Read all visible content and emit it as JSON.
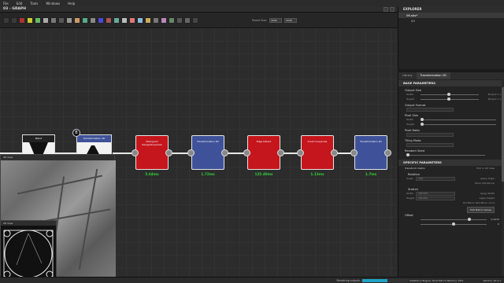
{
  "menu": [
    "File",
    "Edit",
    "Tools",
    "Windows",
    "Help"
  ],
  "graph": {
    "title": "03 - GRAPH",
    "parent_size_label": "Parent Size:",
    "parent_size_w": "4096",
    "parent_size_h": "4096"
  },
  "nodes": [
    {
      "title": "Blend"
    },
    {
      "title": "Transformation 2D",
      "badge": "B"
    },
    {
      "title": "Histogram Range/Grayscale",
      "timing": "5.64ms"
    },
    {
      "title": "Transformation 2D",
      "timing": "1.72ms"
    },
    {
      "title": "Edge Detect",
      "timing": "125.49ms"
    },
    {
      "title": "Invert Grayscale",
      "timing": "1.13ms"
    },
    {
      "title": "Transformation 2D",
      "timing": "1.7ms"
    }
  ],
  "view3d": {
    "title": "3D View"
  },
  "view2d": {
    "title": "2D View"
  },
  "explorer": {
    "title": "EXPLORER",
    "items": [
      "06.sbs*",
      "03"
    ]
  },
  "props": {
    "tabs": [
      "Library",
      "Transformation 2D"
    ],
    "base_section": "BASE PARAMETERS",
    "output_size": "Output Size",
    "width_label": "Width",
    "height_label": "Height",
    "width_value": "0",
    "height_value": "0",
    "width_extra": "Input x 1",
    "height_extra": "Input x 1",
    "output_format": "Output Format",
    "pixel_size": "Pixel Size",
    "pixel_ratio": "Pixel Ratio",
    "tiling_mode": "Tiling Mode",
    "random_seed": "Random Seed",
    "specific_section": "SPECIFIC PARAMETERS",
    "transform_matrix": "Transform matrix",
    "edit_in_2d": "Edit in 2D View",
    "rotation": "Rotation",
    "angle_label": "Angle",
    "angle_value": "0.00",
    "apply_angle": "Apply Angle",
    "rot_buttons": "90cw  180  90ccw",
    "stretch": "Stretch",
    "width_pct": "100.00%",
    "height_pct": "100.00%",
    "apply_width": "Apply Width",
    "apply_height": "Apply Height",
    "mirror_buttons": "Hor.Mirror  Vert.Mirror  x2  /2",
    "edit_matrix": "Edit Matrix Values",
    "offset": "Offset",
    "offset_x": "0.4270",
    "offset_y": "0"
  },
  "status": {
    "text": "Rendering outputs...",
    "progress": 0.55,
    "engine": "Substance Engine: Direct3D 11  Memory: 24%",
    "version": "Version: 10.2.1"
  },
  "colors": {
    "node_red": "#c4161c",
    "node_blue": "#3f5299",
    "timing_green": "#31d23b",
    "progress_blue": "#1fa3c4"
  }
}
